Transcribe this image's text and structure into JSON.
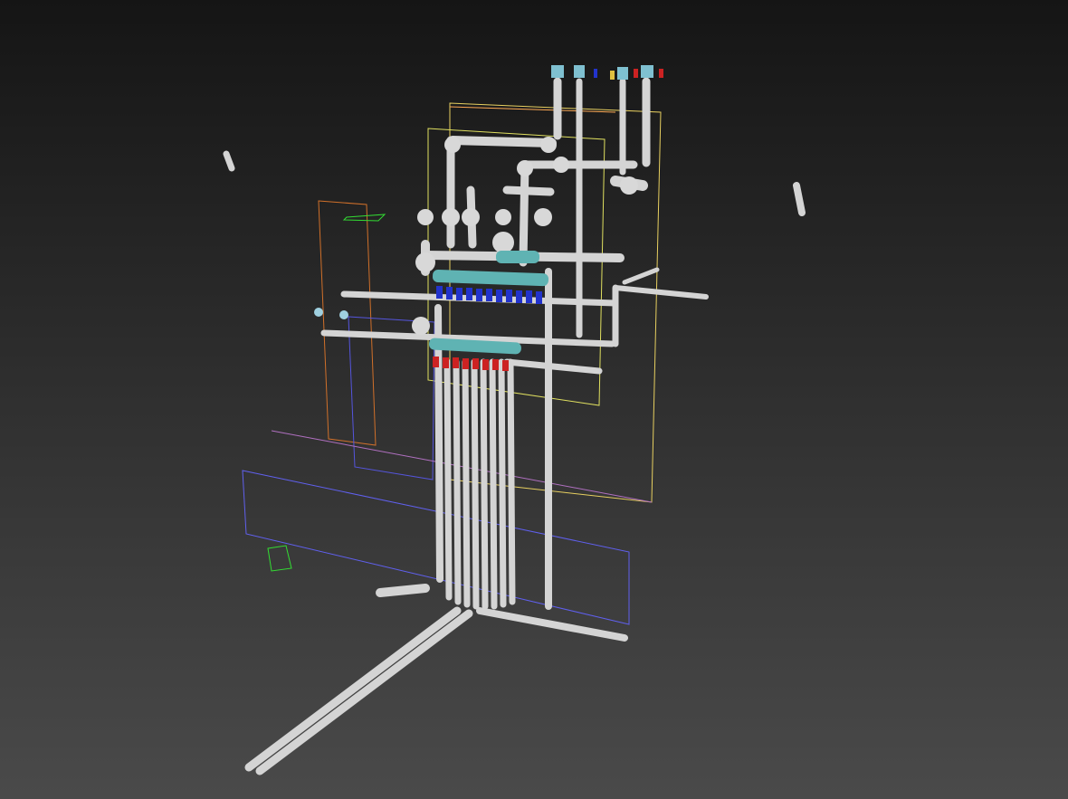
{
  "viewport": {
    "background_top": "#151515",
    "background_bottom": "#4a4a4a",
    "pipe_color": "#d4d4d4",
    "manifold_color": "#5fb3b3",
    "supply_valve_color": "#2233cc",
    "return_valve_color": "#cc2222",
    "wire_colors": [
      "#e0e060",
      "#ff9966",
      "#6666ff",
      "#33dd33",
      "#cc88cc",
      "#ff7f27"
    ]
  }
}
